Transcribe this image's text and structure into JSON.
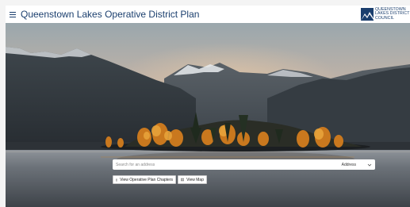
{
  "header": {
    "menu_icon": "hamburger-menu-icon",
    "title": "Queenstown Lakes Operative District Plan",
    "logo": {
      "line1": "QUEENSTOWN",
      "line2": "LAKES DISTRICT",
      "line3": "COUNCIL",
      "mark_icon": "mountain-logo-icon"
    }
  },
  "search": {
    "placeholder": "Search for an address",
    "filter_value": "Address",
    "filter_icon": "chevron-down-icon"
  },
  "actions": {
    "chapters_label": "View Operative Plan Chapters",
    "chapters_icon": "document-icon",
    "map_label": "View Map",
    "map_icon": "map-icon"
  },
  "colors": {
    "brand": "#1b3f6e",
    "header_bg": "#ffffff",
    "page_bg": "#f4f4f4"
  }
}
